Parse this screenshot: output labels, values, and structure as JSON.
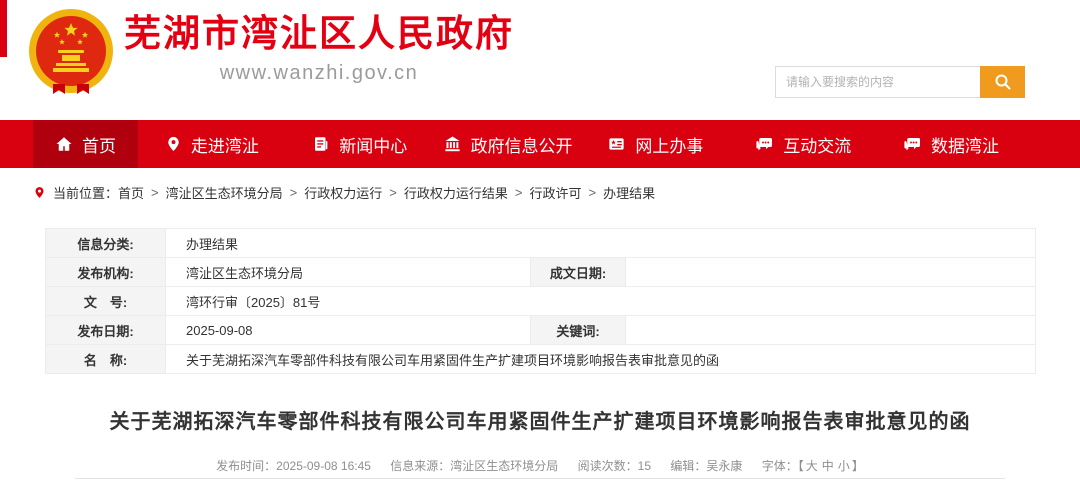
{
  "colors": {
    "nav_red": "#d90010",
    "nav_active_red": "#b0000e",
    "brand_red": "#e30012",
    "search_orange": "#f09a1e",
    "emblem_gold": "#f0b40f",
    "emblem_red": "#de2910",
    "label_bg": "#f4f4f4"
  },
  "header": {
    "emblem_icon": "china-national-emblem",
    "site_name": "芜湖市湾沚区人民政府",
    "site_url": "www.wanzhi.gov.cn",
    "search": {
      "placeholder": "请输入要搜索的内容",
      "button_icon": "search-icon"
    }
  },
  "nav": {
    "items": [
      {
        "label": "首页",
        "icon": "home-icon",
        "active": true
      },
      {
        "label": "走进湾沚",
        "icon": "location-pin-icon",
        "active": false
      },
      {
        "label": "新闻中心",
        "icon": "news-document-icon",
        "active": false
      },
      {
        "label": "政府信息公开",
        "icon": "government-building-icon",
        "active": false
      },
      {
        "label": "网上办事",
        "icon": "service-card-icon",
        "active": false
      },
      {
        "label": "互动交流",
        "icon": "chat-bubbles-icon",
        "active": false
      },
      {
        "label": "数据湾沚",
        "icon": "data-chat-icon",
        "active": false
      }
    ]
  },
  "breadcrumb": {
    "icon": "location-pin-icon",
    "prefix": "当前位置：",
    "separator": ">",
    "items": [
      "首页",
      "湾沚区生态环境分局",
      "行政权力运行",
      "行政权力运行结果",
      "行政许可",
      "办理结果"
    ]
  },
  "info_table": {
    "row1_label": "信息分类:",
    "row1_value": "办理结果",
    "row2_label": "发布机构:",
    "row2_value": "湾沚区生态环境分局",
    "row2_label2": "成文日期:",
    "row2_value2": "",
    "row3_label": "文　号:",
    "row3_value": "湾环行审〔2025〕81号",
    "row4_label": "发布日期:",
    "row4_value": "2025-09-08",
    "row4_label2": "关键词:",
    "row4_value2": "",
    "row5_label": "名　称:",
    "row5_value": "关于芜湖拓深汽车零部件科技有限公司车用紧固件生产扩建项目环境影响报告表审批意见的函"
  },
  "article": {
    "title": "关于芜湖拓深汽车零部件科技有限公司车用紧固件生产扩建项目环境影响报告表审批意见的函",
    "meta": {
      "publish_time_label": "发布时间：",
      "publish_time": "2025-09-08 16:45",
      "source_label": "信息来源：",
      "source": "湾沚区生态环境分局",
      "views_label": "阅读次数：",
      "views": "15",
      "editor_label": "编辑：",
      "editor": "吴永康",
      "font_label": "字体：",
      "bracket_open": "【",
      "font_large": "大",
      "font_medium": "中",
      "font_small": "小",
      "bracket_close": "】"
    }
  }
}
